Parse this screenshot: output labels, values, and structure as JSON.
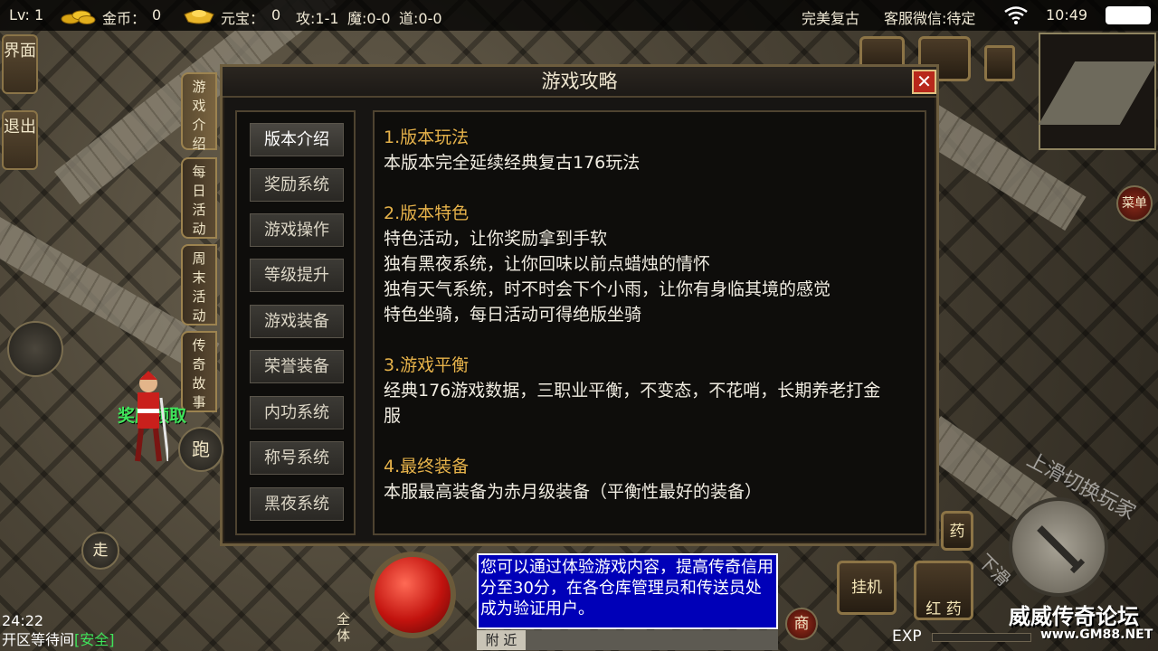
{
  "status_bar": {
    "level": "Lv: 1",
    "gold_label": "金币：",
    "gold_value": "0",
    "ingot_label": "元宝：",
    "ingot_value": "0",
    "attack": "攻:1-1",
    "magic": "魔:0-0",
    "tao": "道:0-0",
    "server_name": "完美复古",
    "service": "客服微信:待定",
    "clock": "10:49"
  },
  "side_buttons": {
    "interface": "界面",
    "exit": "退出"
  },
  "dialog": {
    "title": "游戏攻略",
    "close_label": "✕",
    "vertical_tabs": [
      "游戏介绍",
      "每日活动",
      "周末活动",
      "传奇故事"
    ],
    "menu": [
      "版本介绍",
      "奖励系统",
      "游戏操作",
      "等级提升",
      "游戏装备",
      "荣誉装备",
      "内功系统",
      "称号系统",
      "黑夜系统"
    ],
    "sections": [
      {
        "heading": "1.版本玩法",
        "lines": [
          "本版本完全延续经典复古176玩法"
        ]
      },
      {
        "heading": "2.版本特色",
        "lines": [
          "特色活动，让你奖励拿到手软",
          "独有黑夜系统，让你回味以前点蜡烛的情怀",
          "独有天气系统，时不时会下个小雨，让你有身临其境的感觉",
          "特色坐骑，每日活动可得绝版坐骑"
        ]
      },
      {
        "heading": "3.游戏平衡",
        "lines": [
          "经典176游戏数据，三职业平衡，不变态，不花哨，长期养老打金",
          "服"
        ]
      },
      {
        "heading": "4.最终装备",
        "lines": [
          "本服最高装备为赤月级装备（平衡性最好的装备）"
        ]
      }
    ]
  },
  "hud": {
    "run": "跑",
    "walk": "走",
    "npc_label": "奖励领取",
    "time": "24:22",
    "zone_status": "开区等待间",
    "safe": "[安全]",
    "all_chat": "全体",
    "chat_text": "您可以通过体验游戏内容，提高传奇信用分至30分，在各仓库管理员和传送员处成为验证用户。",
    "chat_tab": "附 近",
    "shop": "商",
    "auto": "挂机",
    "red_potion": "红 药",
    "potion": "药",
    "menu_side": "菜单",
    "exp": "EXP",
    "gesture_up": "上滑切换玩家",
    "gesture_down": "下滑",
    "watermark": "威威传奇论坛",
    "watermark_url": "www.GM88.NET"
  },
  "colors": {
    "heading": "#e6b24a",
    "text": "#f1ede2",
    "safe": "#3fe45a",
    "chat_bg": "#0000b8",
    "close": "#b8281b"
  }
}
